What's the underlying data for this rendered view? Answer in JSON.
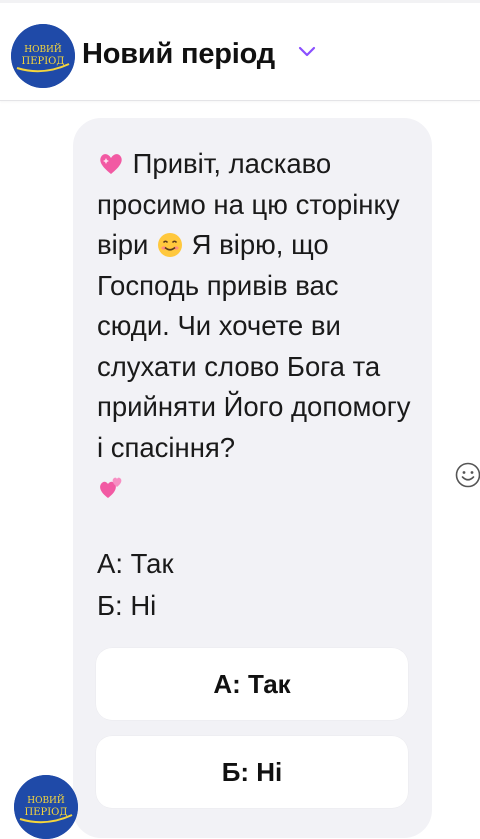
{
  "header": {
    "page_name": "Новий період",
    "avatar_logo_text_top": "НОВИЙ",
    "avatar_logo_text_bottom": "ПЕРІОД"
  },
  "message": {
    "text_part1": "Привіт, ласкаво просимо на цю сторінку віри ",
    "text_part2": " Я вірю, що Господь привів вас сюди. Чи хочете ви слухати слово Бога та прийняти Його допомогу і спасіння?",
    "emoji_start": "sparkling-heart",
    "emoji_mid": "smiling-face",
    "emoji_end": "revolving-hearts",
    "option_a": "А: Так",
    "option_b": "Б: Ні"
  },
  "quick_replies": [
    {
      "label": "А: Так"
    },
    {
      "label": "Б: Ні"
    }
  ],
  "colors": {
    "accent": "#8a4fff",
    "bubble": "#f2f2f6",
    "avatar": "#1f4aa8",
    "logo_text": "#f5d63c"
  }
}
